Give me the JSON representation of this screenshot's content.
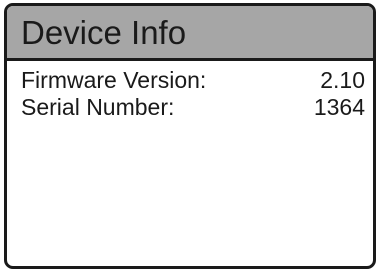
{
  "screen": {
    "title": "Device Info",
    "rows": [
      {
        "label": "Firmware Version:",
        "value": "2.10"
      },
      {
        "label": "Serial Number:",
        "value": "1364"
      }
    ]
  },
  "colors": {
    "title_bar_bg": "#a6a6a6",
    "border": "#1a1a1a",
    "text": "#1a1a1a",
    "background": "#ffffff"
  }
}
